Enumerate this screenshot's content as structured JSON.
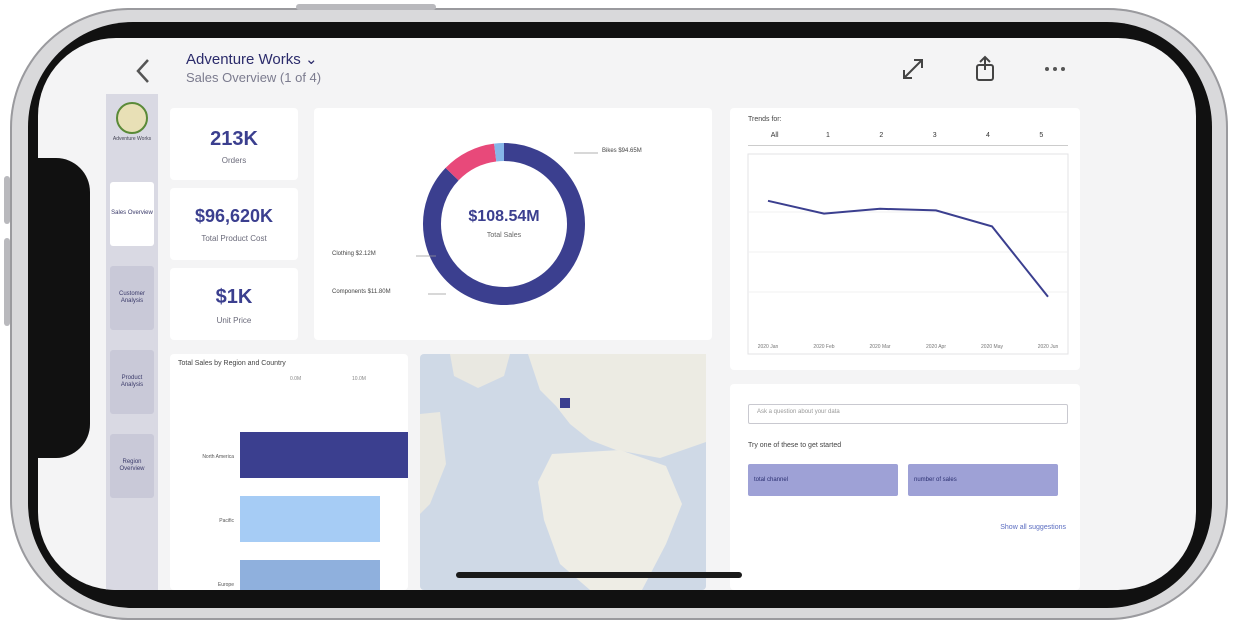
{
  "header": {
    "title": "Adventure Works",
    "subtitle": "Sales Overview (1 of 4)",
    "title_chevron": "⌄"
  },
  "nav": {
    "logo_text": "Adventure Works",
    "items": [
      {
        "label": "Sales Overview"
      },
      {
        "label": "Customer Analysis"
      },
      {
        "label": "Product Analysis"
      },
      {
        "label": "Region Overview"
      }
    ]
  },
  "kpis": [
    {
      "value": "213K",
      "label": "Orders"
    },
    {
      "value": "$96,620K",
      "label": "Total Product Cost"
    },
    {
      "value": "$1K",
      "label": "Unit Price"
    }
  ],
  "donut": {
    "center_value": "$108.54M",
    "center_label": "Total Sales",
    "labels": {
      "bikes": "Bikes $94.65M",
      "clothing": "Clothing $2.12M",
      "components": "Components $11.80M"
    }
  },
  "chart_data": [
    {
      "type": "pie",
      "title": "",
      "categories": [
        "Bikes",
        "Components",
        "Clothing"
      ],
      "values": [
        94.65,
        11.8,
        2.12
      ],
      "unit": "$M",
      "colors": [
        "#3b3f8f",
        "#e8497a",
        "#86b6e8"
      ]
    },
    {
      "type": "line",
      "title": "Trends for:",
      "filters": [
        "All",
        "1",
        "2",
        "3",
        "4",
        "5"
      ],
      "x": [
        "2020 Jan",
        "2020 Feb",
        "2020 Mar",
        "2020 Apr",
        "2020 May",
        "2020 Jun"
      ],
      "series": [
        {
          "values": [
            82,
            74,
            77,
            76,
            66,
            22
          ]
        }
      ],
      "ylim": [
        0,
        100
      ]
    },
    {
      "type": "bar",
      "title": "Total Sales by Region and Country",
      "categories": [
        "North America",
        "Pacific",
        "Europe"
      ],
      "values": [
        9.0,
        7.5,
        7.5
      ],
      "axis_labels": [
        "0.0M",
        "10.0M"
      ]
    }
  ],
  "trends": {
    "title": "Trends for:",
    "filters": [
      "All",
      "1",
      "2",
      "3",
      "4",
      "5"
    ]
  },
  "bar_chart": {
    "title": "Total Sales by Region and Country",
    "axis_labels": [
      "0.0M",
      "10.0M"
    ],
    "categories": [
      "North America",
      "Pacific",
      ""
    ]
  },
  "qa": {
    "placeholder": "Ask a question about your data",
    "prompt": "Try one of these to get started",
    "buttons": [
      "total channel",
      "number of sales"
    ],
    "link": "Show all suggestions"
  },
  "icons": {
    "back": "chevron-left-icon",
    "expand": "expand-icon",
    "share": "share-icon",
    "more": "more-icon"
  }
}
